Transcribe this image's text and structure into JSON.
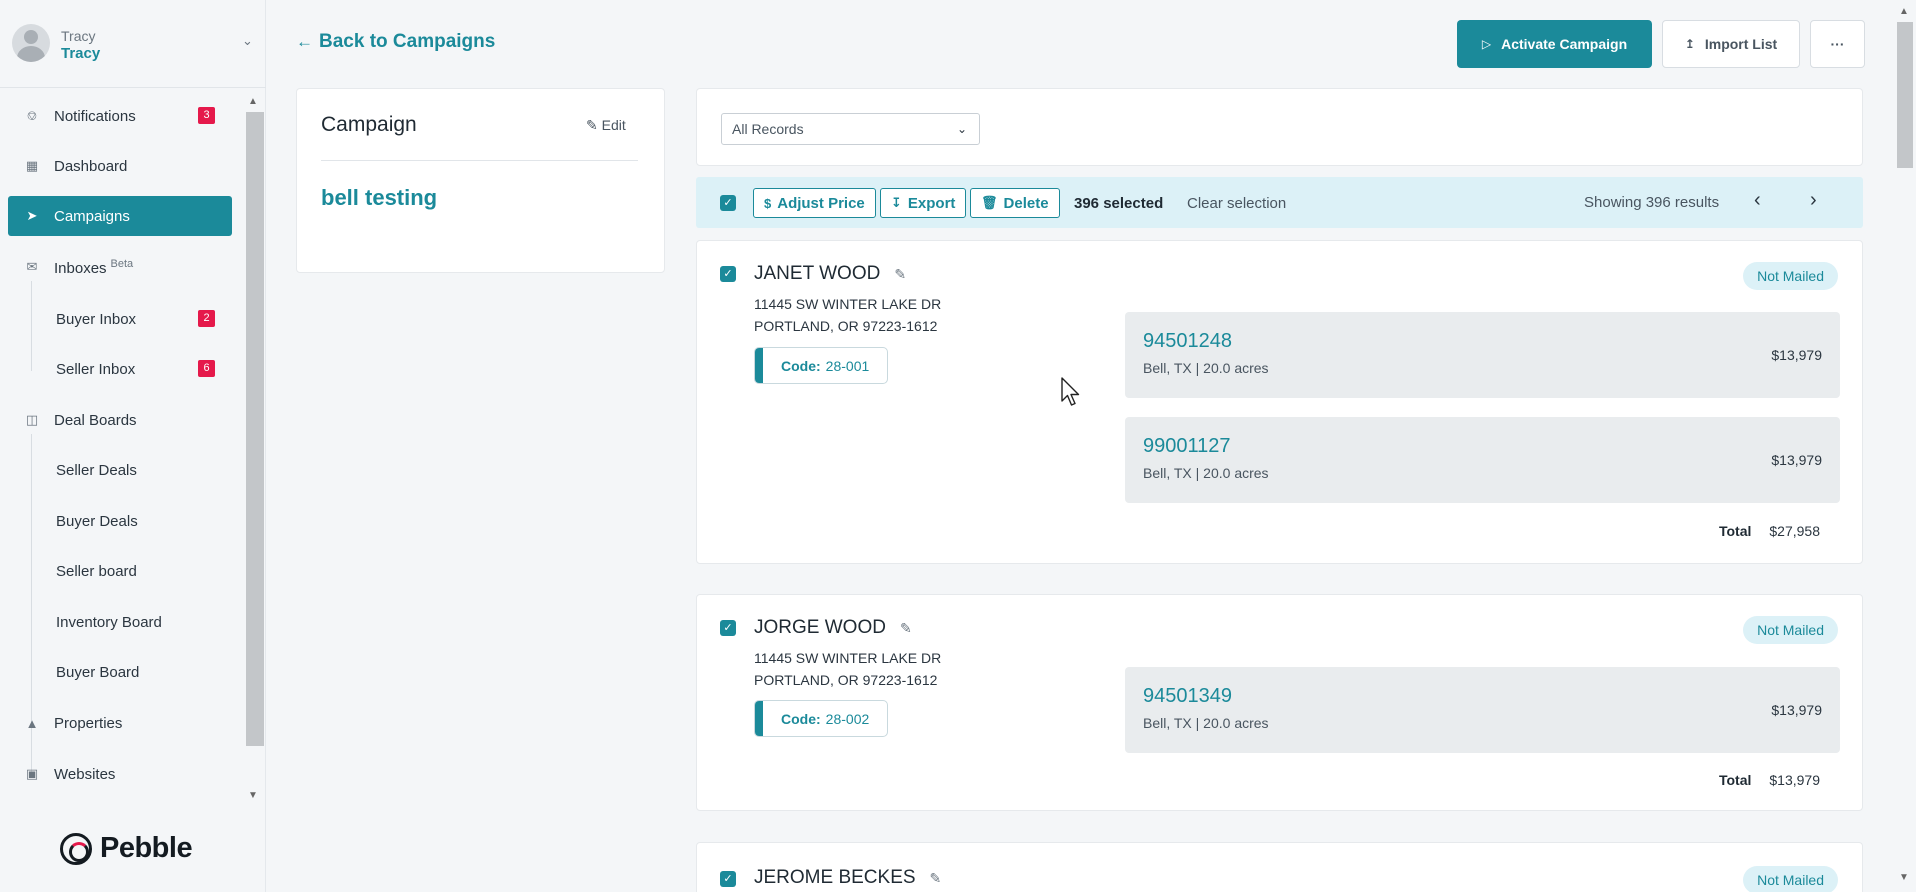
{
  "user": {
    "label": "Tracy",
    "name": "Tracy"
  },
  "nav": {
    "notifications": {
      "label": "Notifications",
      "badge": "3"
    },
    "dashboard": {
      "label": "Dashboard"
    },
    "campaigns": {
      "label": "Campaigns"
    },
    "inboxes": {
      "label": "Inboxes",
      "sup": "Beta"
    },
    "buyer_inbox": {
      "label": "Buyer Inbox",
      "badge": "2"
    },
    "seller_inbox": {
      "label": "Seller Inbox",
      "badge": "6"
    },
    "deal_boards": {
      "label": "Deal Boards"
    },
    "seller_deals": {
      "label": "Seller Deals"
    },
    "buyer_deals": {
      "label": "Buyer Deals"
    },
    "seller_board": {
      "label": "Seller board"
    },
    "inventory_board": {
      "label": "Inventory Board"
    },
    "buyer_board": {
      "label": "Buyer Board"
    },
    "properties": {
      "label": "Properties"
    },
    "websites": {
      "label": "Websites"
    }
  },
  "brand": {
    "name": "Pebble",
    "accent": "#1b8a9a",
    "badge_color": "#e5194b"
  },
  "header": {
    "back_label": "Back to Campaigns",
    "activate_label": "Activate Campaign",
    "import_label": "Import List",
    "more_label": "···"
  },
  "campaign": {
    "heading": "Campaign",
    "edit_label": "Edit",
    "name": "bell testing"
  },
  "filter": {
    "selected": "All Records"
  },
  "selection": {
    "adjust_price": "Adjust Price",
    "export": "Export",
    "delete": "Delete",
    "selected_text": "396 selected",
    "clear_text": "Clear selection",
    "showing_text": "Showing 396 results"
  },
  "records": [
    {
      "name": "JANET WOOD",
      "address1": "11445 SW WINTER LAKE DR",
      "address2": "PORTLAND, OR 97223-1612",
      "code_label": "Code:",
      "code": "28-001",
      "status": "Not Mailed",
      "parcels": [
        {
          "id": "94501248",
          "meta": "Bell, TX | 20.0 acres",
          "price": "$13,979"
        },
        {
          "id": "99001127",
          "meta": "Bell, TX | 20.0 acres",
          "price": "$13,979"
        }
      ],
      "total_label": "Total",
      "total": "$27,958"
    },
    {
      "name": "JORGE WOOD",
      "address1": "11445 SW WINTER LAKE DR",
      "address2": "PORTLAND, OR 97223-1612",
      "code_label": "Code:",
      "code": "28-002",
      "status": "Not Mailed",
      "parcels": [
        {
          "id": "94501349",
          "meta": "Bell, TX | 20.0 acres",
          "price": "$13,979"
        }
      ],
      "total_label": "Total",
      "total": "$13,979"
    },
    {
      "name": "JEROME BECKES",
      "status": "Not Mailed"
    }
  ]
}
